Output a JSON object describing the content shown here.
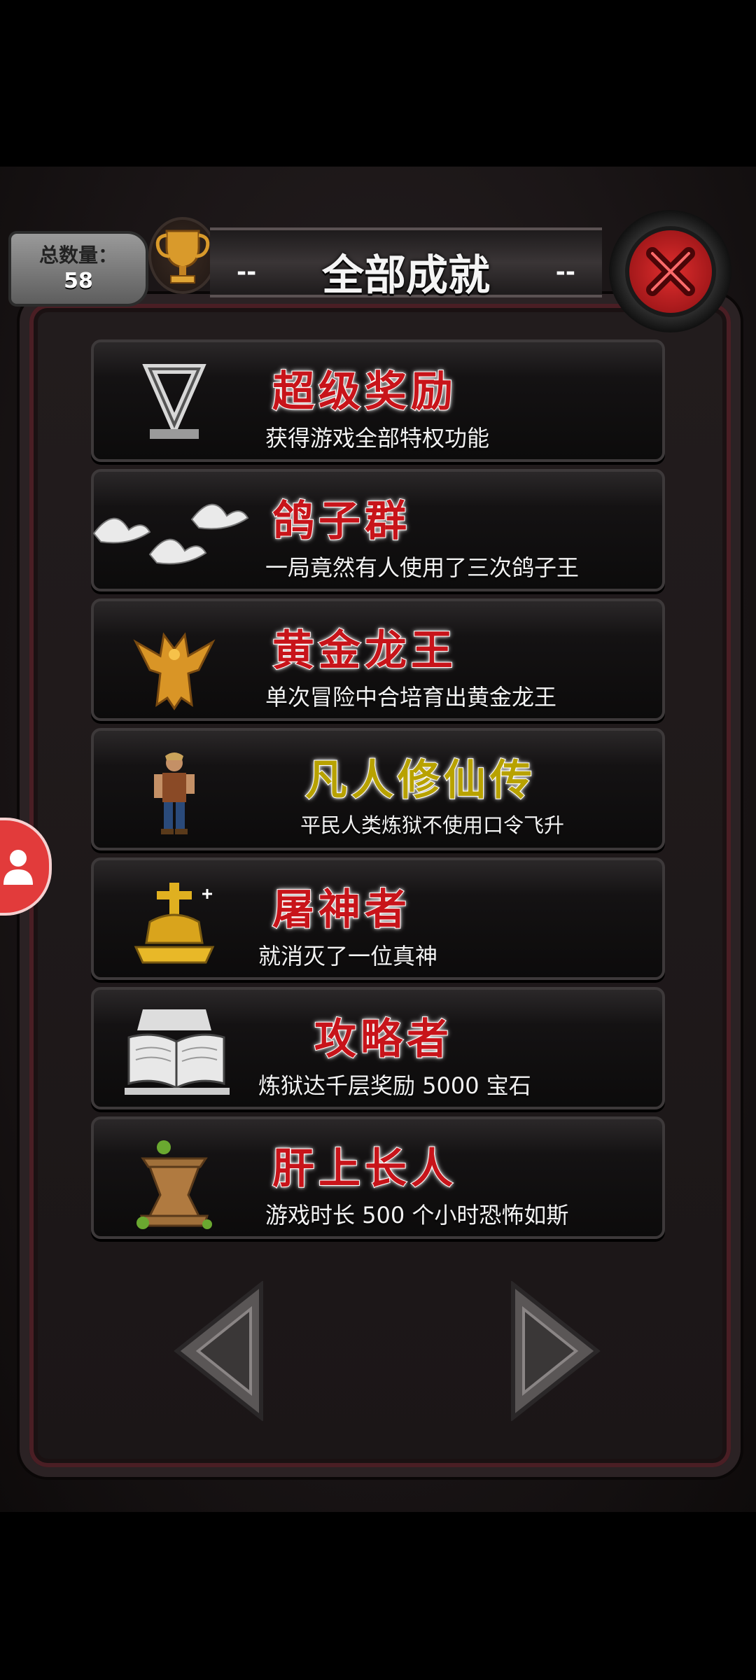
{
  "header": {
    "count_label": "总数量：",
    "count_value": "58",
    "title": "全部成就",
    "title_dash_left": "--",
    "title_dash_right": "--"
  },
  "achievements": [
    {
      "title": "超级奖励",
      "desc": "获得游戏全部特权功能",
      "title_color": "#c8141a",
      "icon": "silver-hourglass-icon"
    },
    {
      "title": "鸽子群",
      "desc": "一局竟然有人使用了三次鸽子王",
      "title_color": "#c8141a",
      "icon": "white-doves-icon"
    },
    {
      "title": "黄金龙王",
      "desc": "单次冒险中合培育出黄金龙王",
      "title_color": "#c8141a",
      "icon": "golden-dragon-icon"
    },
    {
      "title": "凡人修仙传",
      "desc": "平民人类炼狱不使用口令飞升",
      "title_color": "#b8a200",
      "icon": "commoner-icon"
    },
    {
      "title": "屠神者",
      "desc": "就消灭了一位真神",
      "title_color": "#c8141a",
      "icon": "golden-altar-icon"
    },
    {
      "title": "攻略者",
      "desc": "炼狱达千层奖励 5000 宝石",
      "title_color": "#c8141a",
      "icon": "open-book-icon"
    },
    {
      "title": "肝上长人",
      "desc": "游戏时长 500 个小时恐怖如斯",
      "title_color": "#c8141a",
      "icon": "wooden-hourglass-icon"
    }
  ],
  "colors": {
    "accent_red": "#c8141a",
    "accent_gold": "#b8a200",
    "panel": "#1b1617"
  }
}
